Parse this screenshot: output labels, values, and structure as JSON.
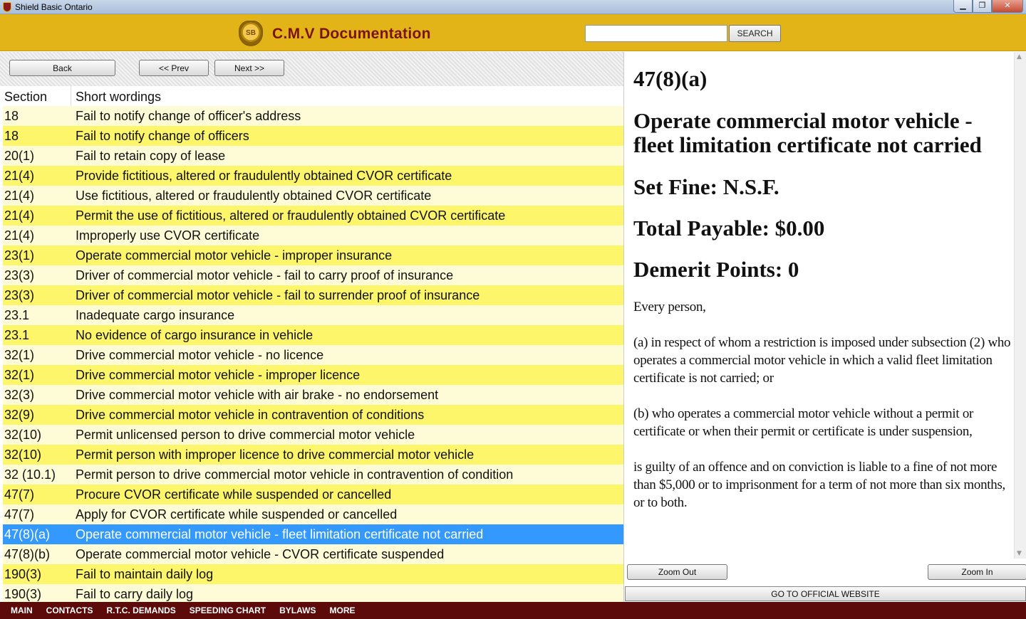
{
  "window": {
    "title": "Shield Basic Ontario",
    "minimize_glyph": "▁",
    "maximize_glyph": "❐",
    "close_glyph": "✕"
  },
  "header": {
    "logo_text": "SB",
    "title": "C.M.V Documentation",
    "search_value": "",
    "search_button": "SEARCH"
  },
  "nav": {
    "back": "Back",
    "prev": "<< Prev",
    "next": "Next >>"
  },
  "list": {
    "columns": [
      "Section",
      "Short wordings"
    ],
    "rows": [
      {
        "section": "18",
        "wording": "Fail to notify change of officer's address"
      },
      {
        "section": "18",
        "wording": "Fail to notify change of officers"
      },
      {
        "section": "20(1)",
        "wording": "Fail to retain copy of lease"
      },
      {
        "section": "21(4)",
        "wording": "Provide fictitious, altered or fraudulently obtained CVOR certificate"
      },
      {
        "section": "21(4)",
        "wording": "Use fictitious, altered or fraudulently obtained CVOR certificate"
      },
      {
        "section": "21(4)",
        "wording": "Permit the use of fictitious, altered or fraudulently obtained CVOR certificate"
      },
      {
        "section": "21(4)",
        "wording": "Improperly use CVOR certificate"
      },
      {
        "section": "23(1)",
        "wording": "Operate commercial motor vehicle - improper insurance"
      },
      {
        "section": "23(3)",
        "wording": "Driver of commercial motor vehicle - fail to carry proof of insurance"
      },
      {
        "section": "23(3)",
        "wording": "Driver of commercial motor vehicle - fail to surrender proof of insurance"
      },
      {
        "section": "23.1",
        "wording": "Inadequate cargo insurance"
      },
      {
        "section": "23.1",
        "wording": "No evidence of cargo insurance in vehicle"
      },
      {
        "section": "32(1)",
        "wording": "Drive commercial motor vehicle - no licence"
      },
      {
        "section": "32(1)",
        "wording": "Drive commercial motor vehicle - improper licence"
      },
      {
        "section": "32(3)",
        "wording": "Drive commercial motor vehicle with air brake - no endorsement"
      },
      {
        "section": "32(9)",
        "wording": "Drive commercial motor vehicle in contravention of conditions"
      },
      {
        "section": "32(10)",
        "wording": "Permit unlicensed person to drive commercial motor vehicle"
      },
      {
        "section": "32(10)",
        "wording": "Permit person with improper licence to drive commercial motor vehicle"
      },
      {
        "section": "32 (10.1)",
        "wording": "Permit person to drive commercial motor vehicle in contravention of condition"
      },
      {
        "section": "47(7)",
        "wording": "Procure CVOR certificate while suspended or cancelled"
      },
      {
        "section": "47(7)",
        "wording": "Apply for CVOR certificate while suspended or cancelled"
      },
      {
        "section": "47(8)(a)",
        "wording": "Operate commercial motor vehicle - fleet limitation certificate not carried"
      },
      {
        "section": "47(8)(b)",
        "wording": "Operate commercial motor vehicle - CVOR certificate suspended"
      },
      {
        "section": "190(3)",
        "wording": "Fail to maintain daily log"
      },
      {
        "section": "190(3)",
        "wording": "Fail to carry daily log"
      }
    ],
    "selected_index": 21
  },
  "detail": {
    "section": "47(8)(a)",
    "title": "Operate commercial motor vehicle - fleet limitation certificate not carried",
    "set_fine": "Set Fine: N.S.F.",
    "total_payable": "Total Payable: $0.00",
    "demerit_points": "Demerit Points: 0",
    "paragraphs": [
      "Every person,",
      "(a) in respect of whom a restriction is imposed under subsection (2) who operates a commercial motor vehicle in which a valid fleet limitation certificate is not carried; or",
      "(b) who operates a commercial motor vehicle without a permit or certificate or when their permit or certificate is under suspension,",
      "is guilty of an offence and on conviction is liable to a fine of not more than $5,000 or to imprisonment for a term of not more than six months, or to both."
    ],
    "zoom_out": "Zoom Out",
    "zoom_in": "Zoom In",
    "website": "GO TO OFFICIAL WEBSITE"
  },
  "bottom_menu": [
    "MAIN",
    "CONTACTS",
    "R.T.C. DEMANDS",
    "SPEEDING CHART",
    "BYLAWS",
    "MORE"
  ],
  "colors": {
    "header": "#e3b418",
    "title_text": "#7a1414",
    "row_light": "#fefcd6",
    "row_yellow": "#fdf56a",
    "row_selected": "#3399ff",
    "bottom_bar": "#5c0a0a"
  }
}
